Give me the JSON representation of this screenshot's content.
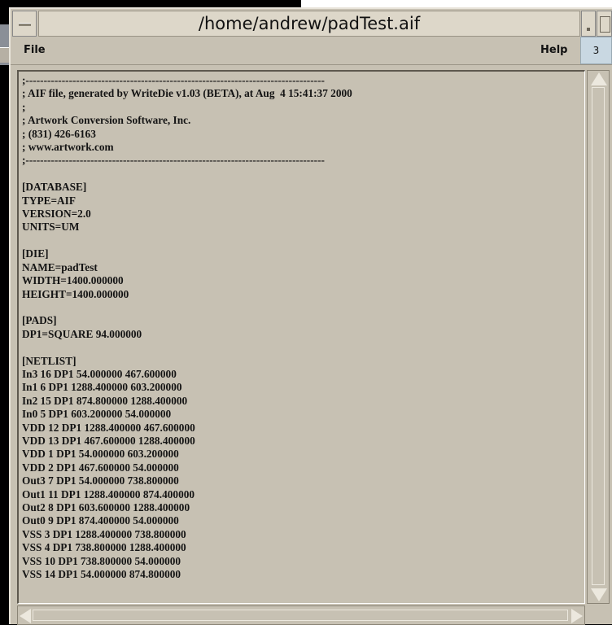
{
  "window": {
    "title": "/home/andrew/padTest.aif"
  },
  "menubar": {
    "file_label": "File",
    "help_label": "Help",
    "workspace_number": "3"
  },
  "document": {
    "lines": [
      ";-----------------------------------------------------------------------------------",
      "; AIF file, generated by WriteDie v1.03 (BETA), at Aug  4 15:41:37 2000",
      ";",
      "; Artwork Conversion Software, Inc.",
      "; (831) 426-6163",
      "; www.artwork.com",
      ";-----------------------------------------------------------------------------------",
      "",
      "[DATABASE]",
      "TYPE=AIF",
      "VERSION=2.0",
      "UNITS=UM",
      "",
      "[DIE]",
      "NAME=padTest",
      "WIDTH=1400.000000",
      "HEIGHT=1400.000000",
      "",
      "[PADS]",
      "DP1=SQUARE 94.000000",
      "",
      "[NETLIST]",
      "In3 16 DP1 54.000000 467.600000",
      "In1 6 DP1 1288.400000 603.200000",
      "In2 15 DP1 874.800000 1288.400000",
      "In0 5 DP1 603.200000 54.000000",
      "VDD 12 DP1 1288.400000 467.600000",
      "VDD 13 DP1 467.600000 1288.400000",
      "VDD 1 DP1 54.000000 603.200000",
      "VDD 2 DP1 467.600000 54.000000",
      "Out3 7 DP1 54.000000 738.800000",
      "Out1 11 DP1 1288.400000 874.400000",
      "Out2 8 DP1 603.600000 1288.400000",
      "Out0 9 DP1 874.400000 54.000000",
      "VSS 3 DP1 1288.400000 738.800000",
      "VSS 4 DP1 738.800000 1288.400000",
      "VSS 10 DP1 738.800000 54.000000",
      "VSS 14 DP1 54.000000 874.800000"
    ]
  },
  "icons": {
    "window_menu": "window-menu-icon",
    "minimize": "minimize-icon",
    "maximize": "maximize-icon",
    "scroll_up": "arrow-up-icon",
    "scroll_down": "arrow-down-icon",
    "scroll_left": "arrow-left-icon",
    "scroll_right": "arrow-right-icon"
  },
  "colors": {
    "window_bg": "#c7c1b3",
    "title_bg": "#ddd7c9",
    "workspace_badge_bg": "#c9d8e2",
    "text": "#141414"
  }
}
